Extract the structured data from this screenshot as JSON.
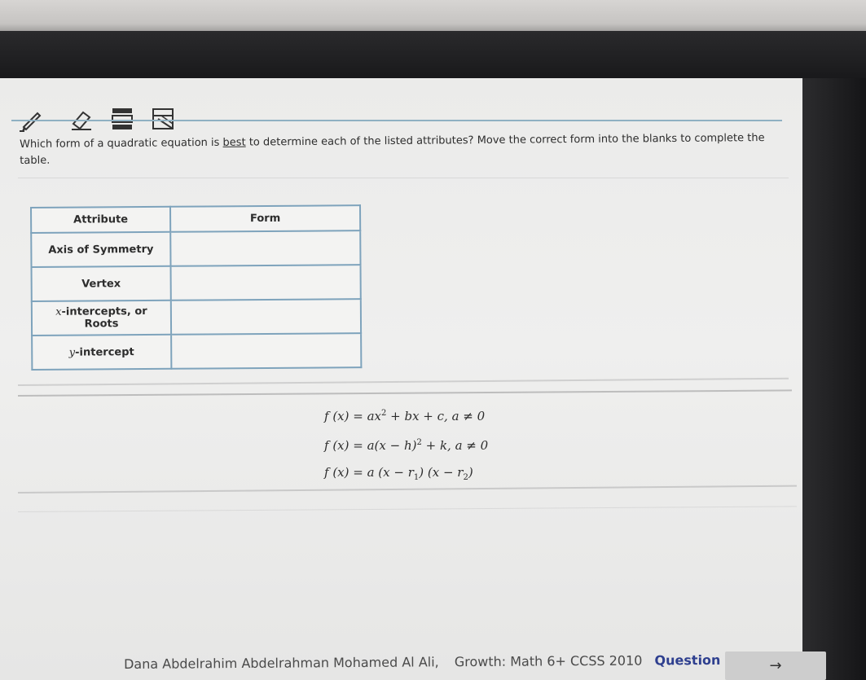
{
  "question": {
    "part1": "Which form of a quadratic equation is ",
    "emphasis": "best",
    "part2": " to determine each of the listed attributes? Move the correct form into the blanks to complete the table."
  },
  "table": {
    "headers": {
      "attribute": "Attribute",
      "form": "Form"
    },
    "rows": [
      {
        "attribute": "Axis of Symmetry",
        "form": ""
      },
      {
        "attribute": "Vertex",
        "form": ""
      },
      {
        "attribute_var": "x",
        "attribute": "-intercepts, or Roots",
        "form": ""
      },
      {
        "attribute_var": "y",
        "attribute": "-intercept",
        "form": ""
      }
    ]
  },
  "forms": {
    "standard": {
      "lhs": "f (x) = ax",
      "exp": "2",
      "rhs": " + bx + c,  a ≠ 0"
    },
    "vertex": {
      "lhs": "f (x) = a(x − h)",
      "exp": "2",
      "rhs": " + k,  a ≠ 0"
    },
    "factored": {
      "p1": "f (x) = a (x − r",
      "s1": "1",
      "p2": ") (x − r",
      "s2": "2",
      "p3": ")"
    }
  },
  "footer": {
    "student": "Dana Abdelrahim Abdelrahman Mohamed Al Ali,",
    "course": "Growth: Math 6+ CCSS 2010",
    "question_label": "Question #"
  },
  "nav": {
    "next_icon": "→"
  },
  "icons": [
    "pencil-icon",
    "eraser-icon",
    "highlighter-icon",
    "reference-sheet-icon"
  ],
  "colors": {
    "table_border": "#7ea3bc",
    "question_label": "#2e3f8f"
  }
}
